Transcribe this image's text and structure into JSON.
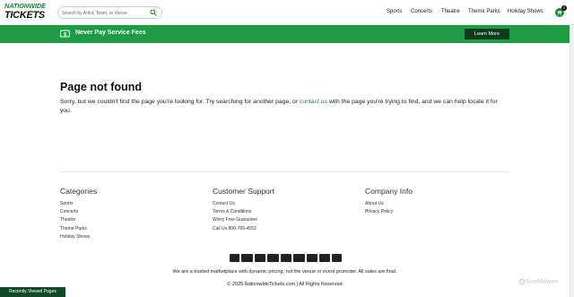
{
  "header": {
    "logo_line1": "NATIONWIDE",
    "logo_line2": "TICKETS",
    "search_placeholder": "Search by Artist, Team, or Venue",
    "nav": [
      "Sports",
      "Concerts",
      "Theatre",
      "Theme Parks",
      "Holiday Shows"
    ],
    "cart_count": "0"
  },
  "banner": {
    "text": "Never Pay Service Fees",
    "button": "Learn More"
  },
  "main": {
    "title": "Page not found",
    "desc_before": "Sorry, but we couldn't find the page you're looking for. Try searching for another page, or ",
    "desc_link": "contact us",
    "desc_after": " with the page you're trying to find, and we can help locate it for you."
  },
  "footer": {
    "categories_title": "Categories",
    "categories": [
      "Sports",
      "Concerts",
      "Theatre",
      "Theme Parks",
      "Holiday Shows"
    ],
    "support_title": "Customer Support",
    "support": [
      "Contact Us",
      "Terms & Conditions",
      "Worry Free Guarantee",
      "Call Us 800-789-4553"
    ],
    "company_title": "Company Info",
    "company": [
      "About Us",
      "Privacy Policy"
    ],
    "payment_icons": [
      "amex-icon",
      "discover-icon",
      "jcb-icon",
      "mastercard-icon",
      "visa-icon",
      "apple-pay-icon",
      "google-pay-icon",
      "paypal-icon",
      "venmo-icon"
    ],
    "trust": "We are a trusted marketplace with dynamic pricing, not the venue or event promoter. All sales are final.",
    "copyright": "© 2025 NationwideTickets.com | All Rights Reserved"
  },
  "widgets": {
    "recently_viewed": "Recently Viewed Pages",
    "scanmalware": "ScanMalware"
  },
  "colors": {
    "brand_green": "#1f9a45",
    "dark_green": "#0e3b1e",
    "link_green": "#1a8a3a"
  }
}
